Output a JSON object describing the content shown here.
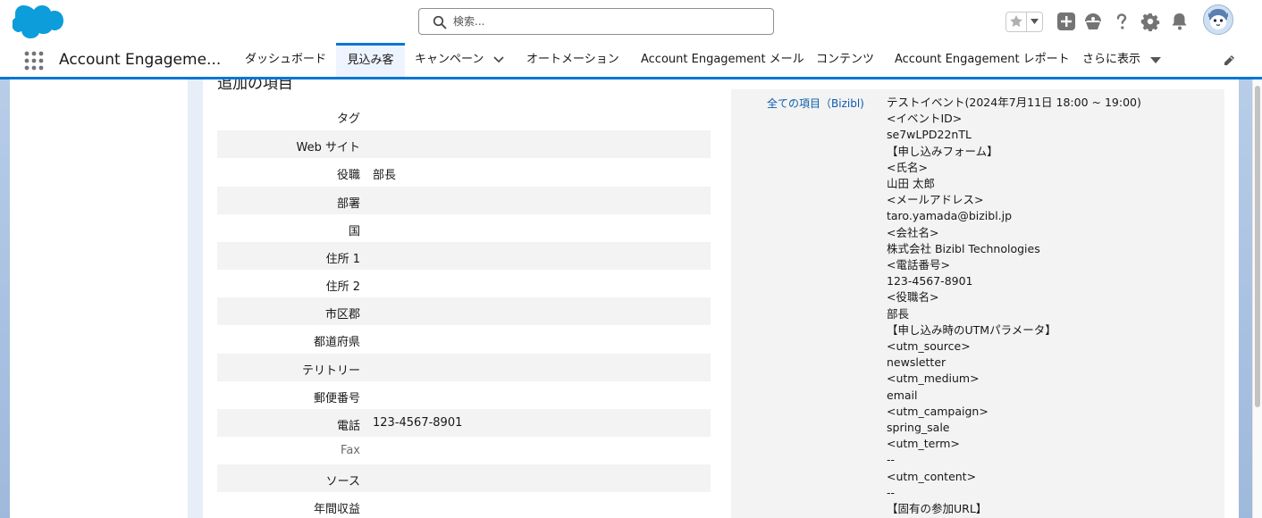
{
  "header": {
    "logo": "salesforce-cloud-logo",
    "search_placeholder": "検索...",
    "icons": [
      "star-icon",
      "chevron-down-icon",
      "add-icon",
      "trailhead-icon",
      "help-icon",
      "gear-icon",
      "bell-icon",
      "avatar"
    ]
  },
  "nav": {
    "app_name": "Account Engageme...",
    "tabs": [
      {
        "label": "ダッシュボード"
      },
      {
        "label": "見込み客"
      },
      {
        "label": "キャンペーン"
      },
      {
        "label": "オートメーション"
      },
      {
        "label": "Account Engagement メール"
      },
      {
        "label": "コンテンツ"
      },
      {
        "label": "Account Engagement レポート"
      },
      {
        "label": "さらに表示"
      }
    ]
  },
  "section": {
    "title": "追加の項目"
  },
  "fields": [
    {
      "label": "タグ",
      "value": ""
    },
    {
      "label": "Web サイト",
      "value": ""
    },
    {
      "label": "役職",
      "value": "部長"
    },
    {
      "label": "部署",
      "value": ""
    },
    {
      "label": "国",
      "value": ""
    },
    {
      "label": "住所 1",
      "value": ""
    },
    {
      "label": "住所 2",
      "value": ""
    },
    {
      "label": "市区郡",
      "value": ""
    },
    {
      "label": "都道府県",
      "value": ""
    },
    {
      "label": "テリトリー",
      "value": ""
    },
    {
      "label": "郵便番号",
      "value": ""
    },
    {
      "label": "電話",
      "value": "123-4567-8901"
    },
    {
      "label": "Fax",
      "value": ""
    },
    {
      "label": "ソース",
      "value": ""
    },
    {
      "label": "年間収益",
      "value": ""
    }
  ],
  "right_field": {
    "label": "全ての項目（Bizibl)",
    "lines": [
      "テストイベント(2024年7月11日 18:00 ~ 19:00)",
      "<イベントID>",
      "se7wLPD22nTL",
      "【申し込みフォーム】",
      "<氏名>",
      "山田 太郎",
      "<メールアドレス>",
      "taro.yamada@bizibl.jp",
      "<会社名>",
      "株式会社 Bizibl Technologies",
      "<電話番号>",
      "123-4567-8901",
      "<役職名>",
      "部長",
      "【申し込み時のUTMパラメータ】",
      "<utm_source>",
      "newsletter",
      "<utm_medium>",
      "email",
      "<utm_campaign>",
      "spring_sale",
      "<utm_term>",
      "--",
      "<utm_content>",
      "--",
      "【固有の参加URL】"
    ]
  },
  "colors": {
    "brand_blue": "#0176d3",
    "link_blue": "#0b5cab",
    "row_shade": "#f3f3f3"
  }
}
